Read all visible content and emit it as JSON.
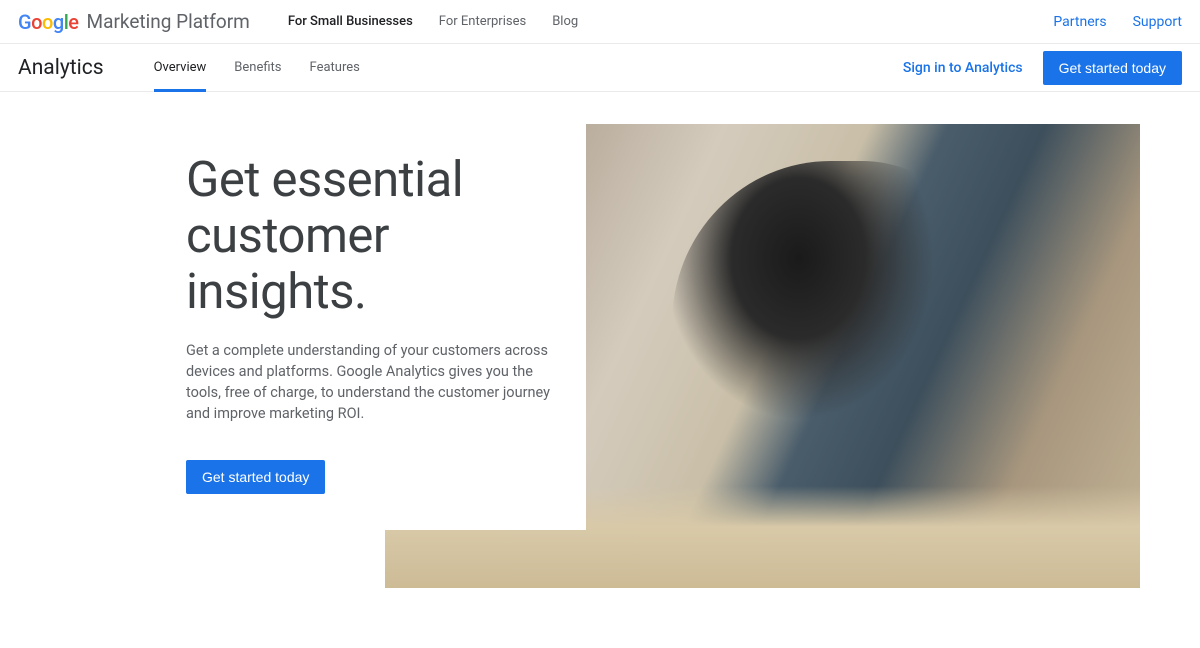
{
  "header": {
    "logo_suffix": "Marketing Platform",
    "nav": [
      {
        "label": "For Small Businesses",
        "active": true
      },
      {
        "label": "For Enterprises",
        "active": false
      },
      {
        "label": "Blog",
        "active": false
      }
    ],
    "right": [
      {
        "label": "Partners"
      },
      {
        "label": "Support"
      }
    ]
  },
  "subnav": {
    "product": "Analytics",
    "tabs": [
      {
        "label": "Overview",
        "active": true
      },
      {
        "label": "Benefits",
        "active": false
      },
      {
        "label": "Features",
        "active": false
      }
    ],
    "signin": "Sign in to Analytics",
    "cta": "Get started today"
  },
  "hero": {
    "title": "Get essential customer insights.",
    "description": "Get a complete understanding of your customers across devices and platforms. Google Analytics gives you the tools, free of charge, to understand the customer journey and improve marketing ROI.",
    "cta": "Get started today"
  }
}
